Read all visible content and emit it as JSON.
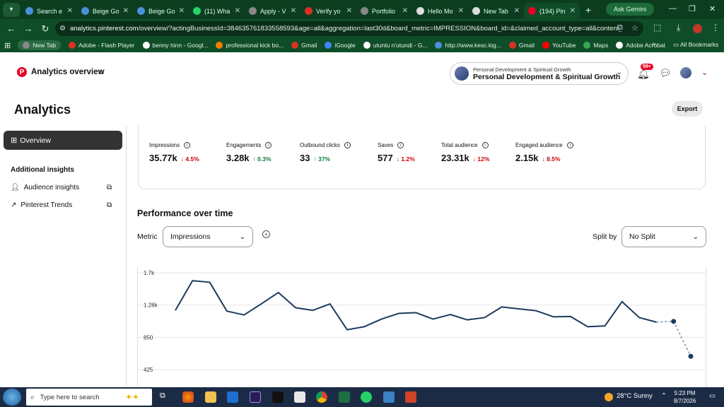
{
  "browser": {
    "tabs": [
      {
        "title": "Search e",
        "color": "#4a90d9"
      },
      {
        "title": "Beige Go",
        "color": "#4a90d9"
      },
      {
        "title": "Beige Go",
        "color": "#4a90d9"
      },
      {
        "title": "(11) Wha",
        "color": "#25d366"
      },
      {
        "title": "Apply - V",
        "color": "#888888"
      },
      {
        "title": "Verify yo",
        "color": "#d93025"
      },
      {
        "title": "Portfolio",
        "color": "#888888"
      },
      {
        "title": "Hello Mo",
        "color": "#dddddd"
      },
      {
        "title": "New Tab",
        "color": "#dddddd"
      },
      {
        "title": "(194) Pin",
        "color": "#e60023"
      }
    ],
    "gemini_label": "Ask Gemini",
    "url_host": "analytics.pinterest.com",
    "url_path": "/overview/?actingBusinessId=384635761833558593&age=all&aggregation=last30d&board_metric=IMPRESSION&board_id=&claimed_account_type=all&content_type...",
    "bookmarks": [
      {
        "label": "New Tab",
        "color": "#888888"
      },
      {
        "label": "Adobe - Flash Player",
        "color": "#d93025"
      },
      {
        "label": "benny hinn - Googl...",
        "color": "#ffffff"
      },
      {
        "label": "professional kick bo...",
        "color": "#f57c00"
      },
      {
        "label": "Gmail",
        "color": "#d93025"
      },
      {
        "label": "iGoogle",
        "color": "#4285f4"
      },
      {
        "label": "utuntu n'utundi - G...",
        "color": "#ffffff"
      },
      {
        "label": "http://www.kesc.kig...",
        "color": "#4a90d9"
      },
      {
        "label": "Gmail",
        "color": "#d93025"
      },
      {
        "label": "YouTube",
        "color": "#ff0000"
      },
      {
        "label": "Maps",
        "color": "#34a853"
      },
      {
        "label": "Adobe Acrobat",
        "color": "#ffffff"
      }
    ],
    "all_bookmarks": "All Bookmarks"
  },
  "header": {
    "title": "Analytics overview",
    "account_small": "Personal Development & Spiritual Growth",
    "account_big": "Personal Development & Spiritual Growth",
    "notif_badge": "99+"
  },
  "page": {
    "heading": "Analytics",
    "export": "Export"
  },
  "sidebar": {
    "overview": "Overview",
    "section": "Additional insights",
    "links": [
      "Audience insights",
      "Pinterest Trends"
    ]
  },
  "metrics": [
    {
      "label": "Impressions",
      "value": "35.77k",
      "change": "4.5%",
      "dir": "down"
    },
    {
      "label": "Engagements",
      "value": "3.28k",
      "change": "0.3%",
      "dir": "up"
    },
    {
      "label": "Outbound clicks",
      "value": "33",
      "change": "37%",
      "dir": "up"
    },
    {
      "label": "Saves",
      "value": "577",
      "change": "1.2%",
      "dir": "down"
    },
    {
      "label": "Total audience",
      "value": "23.31k",
      "change": "12%",
      "dir": "down"
    },
    {
      "label": "Engaged audience",
      "value": "2.15k",
      "change": "8.5%",
      "dir": "down"
    }
  ],
  "performance": {
    "title": "Performance over time",
    "metric_label": "Metric",
    "metric_value": "Impressions",
    "split_label": "Split by",
    "split_value": "No Split"
  },
  "chart_data": {
    "type": "line",
    "ytick_labels": [
      "1.7k",
      "1.28k",
      "850",
      "425"
    ],
    "yticks": [
      1700,
      1275,
      850,
      425
    ],
    "ylim": [
      0,
      1700
    ],
    "grid": true,
    "series": [
      {
        "values": [
          1205,
          1595,
          1575,
          1195,
          1145,
          1290,
          1440,
          1240,
          1205,
          1290,
          950,
          990,
          1090,
          1165,
          1175,
          1090,
          1150,
          1080,
          1110,
          1250,
          1225,
          1200,
          1120,
          1125,
          990,
          1000,
          1320,
          1110,
          1050,
          1060,
          600
        ]
      }
    ],
    "solid_points": 29,
    "line_color": "#1e3a5f"
  },
  "taskbar": {
    "search_placeholder": "Type here to search",
    "weather": "28°C  Sunny",
    "time": "5:23 PM",
    "date": "8/7/2026"
  }
}
